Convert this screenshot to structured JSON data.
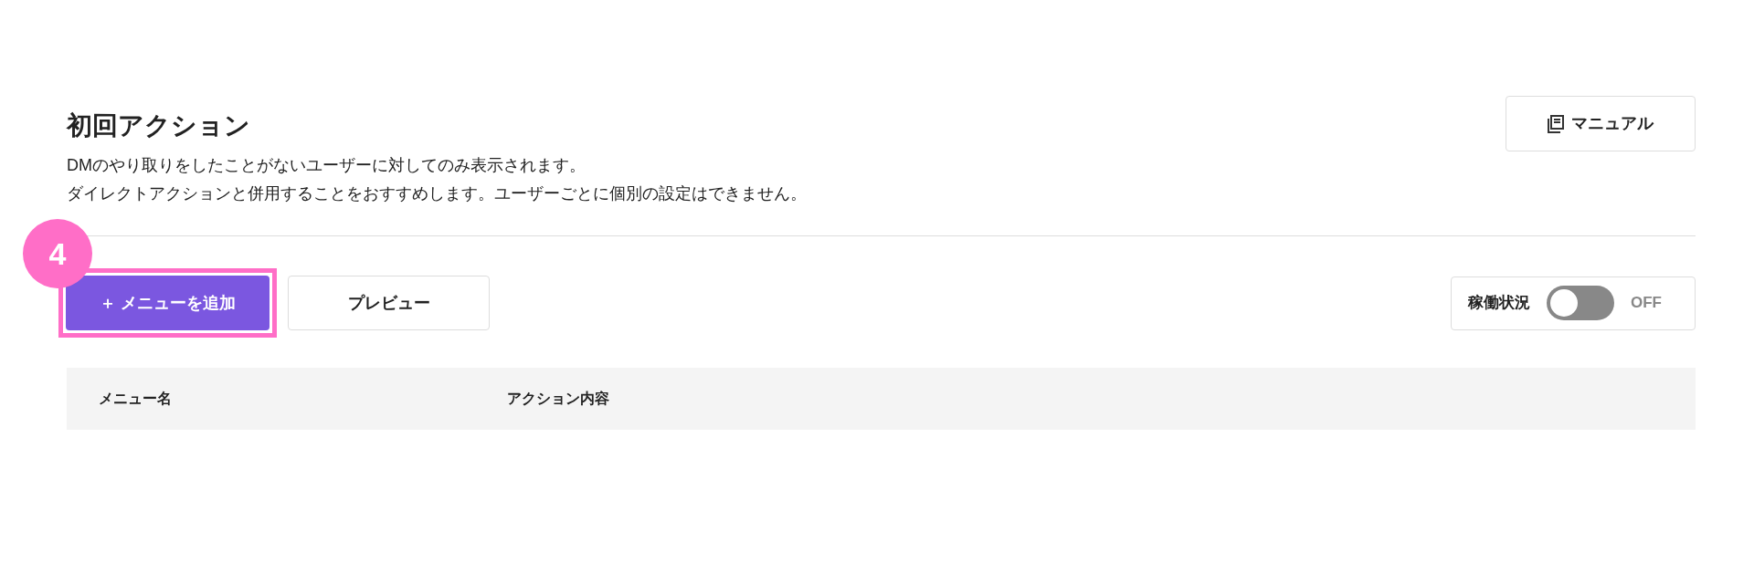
{
  "header": {
    "title": "初回アクション",
    "description": [
      "DMのやり取りをしたことがないユーザーに対してのみ表示されます。",
      "ダイレクトアクションと併用することをおすすめします。ユーザーごとに個別の設定はできません。"
    ],
    "manual_button": "マニュアル"
  },
  "toolbar": {
    "add_button": "＋ メニューを追加",
    "preview_button": "プレビュー",
    "status": {
      "label": "稼働状況",
      "on": false,
      "state_text": "OFF"
    }
  },
  "annotation": {
    "label": "4"
  },
  "table": {
    "columns": [
      "メニュー名",
      "アクション内容"
    ]
  }
}
